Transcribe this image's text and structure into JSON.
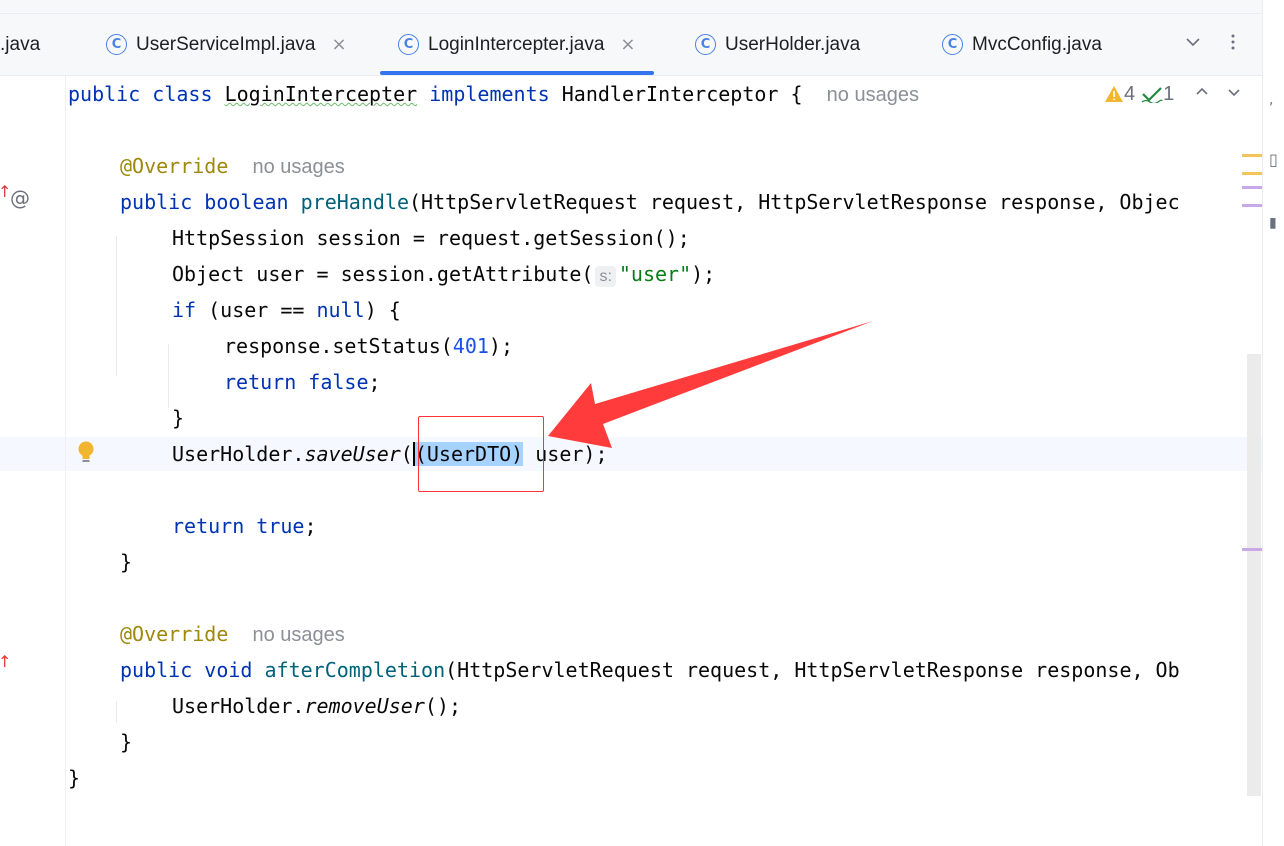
{
  "tabs": [
    {
      "label": ".java",
      "partial": true
    },
    {
      "label": "UserServiceImpl.java",
      "closable": true
    },
    {
      "label": "LoginIntercepter.java",
      "closable": true,
      "active": true
    },
    {
      "label": "UserHolder.java",
      "closable": false
    },
    {
      "label": "MvcConfig.java",
      "closable": false
    }
  ],
  "tab_icon_glyph": "C",
  "tab_close_glyph": "×",
  "tabbar_icons": {
    "dropdown": "chevron-down-icon",
    "more": "more-vertical-icon"
  },
  "header": {
    "warnings": "4",
    "weak_warnings": "1"
  },
  "colors": {
    "accent": "#3574f0",
    "keyword": "#0033b3",
    "annotation": "#9e880d",
    "string": "#067d17",
    "number": "#1750eb",
    "selection": "#a6d2ff",
    "highlight_box": "#ff3333",
    "arrow": "#ff3b3b"
  },
  "code": {
    "class_decl": {
      "kw1": "public",
      "kw2": "class",
      "name": "LoginIntercepter",
      "kw3": "implements",
      "iface": "HandlerInterceptor",
      "brace": " {",
      "hint": "no usages"
    },
    "override1": {
      "ann": "@Override",
      "hint": "no usages"
    },
    "prehandle_sig": {
      "kw1": "public",
      "kw2": "boolean",
      "method": "preHandle",
      "params": "(HttpServletRequest request, HttpServletResponse response, Objec"
    },
    "l_session": "HttpSession session = request.getSession();",
    "l_object": {
      "pre": "Object user = session.getAttribute(",
      "param_hint": "s:",
      "str": "\"user\"",
      "post": ");"
    },
    "l_if": {
      "kw": "if",
      "mid": " (user == ",
      "kw2": "null",
      "post": ") {"
    },
    "l_status": {
      "pre": "response.setStatus(",
      "num": "401",
      "post": ");"
    },
    "l_return_false": {
      "kw1": "return",
      "kw2": "false",
      "post": ";"
    },
    "l_close_if": "}",
    "l_save": {
      "obj": "UserHolder.",
      "method": "saveUser",
      "open": "(",
      "sel": "(UserDTO)",
      "post": " user);"
    },
    "l_return_true": {
      "kw1": "return",
      "kw2": "true",
      "post": ";"
    },
    "l_close_method": "}",
    "override2": {
      "ann": "@Override",
      "hint": "no usages"
    },
    "after_sig": {
      "kw1": "public",
      "kw2": "void",
      "method": "afterCompletion",
      "params": "(HttpServletRequest request, HttpServletResponse response, Ob"
    },
    "l_remove": {
      "obj": "UserHolder.",
      "method": "removeUser",
      "post": "();"
    },
    "l_close_method2": "}",
    "l_close_class": "}"
  },
  "gutter": {
    "override_marker": "↑",
    "at_marker": "@",
    "bulb": "intention-bulb-icon"
  }
}
